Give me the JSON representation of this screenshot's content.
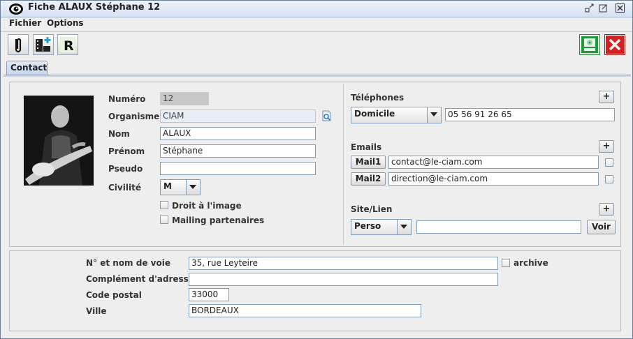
{
  "window": {
    "title": "Fiche ALAUX Stéphane 12"
  },
  "menu": {
    "items": [
      "Fichier",
      "Options"
    ]
  },
  "tabs": [
    "Contact"
  ],
  "identity": {
    "numero_label": "Numéro",
    "numero_value": "12",
    "organisme_label": "Organisme",
    "organisme_value": "CIAM",
    "nom_label": "Nom",
    "nom_value": "ALAUX",
    "prenom_label": "Prénom",
    "prenom_value": "Stéphane",
    "pseudo_label": "Pseudo",
    "pseudo_value": "",
    "civilite_label": "Civilité",
    "civilite_value": "M",
    "droit_image_label": "Droit à l'image",
    "mailing_label": "Mailing partenaires"
  },
  "telephones": {
    "heading": "Téléphones",
    "add": "+",
    "type": "Domicile",
    "number": "05 56 91 26 65"
  },
  "emails": {
    "heading": "Emails",
    "add": "+",
    "rows": [
      {
        "button": "Mail1",
        "value": "contact@le-ciam.com"
      },
      {
        "button": "Mail2",
        "value": "direction@le-ciam.com"
      }
    ]
  },
  "site": {
    "heading": "Site/Lien",
    "add": "+",
    "type": "Perso",
    "value": "",
    "voir_button": "Voir"
  },
  "address": {
    "voie_label": "N° et nom de voie",
    "voie_value": "35, rue Leyteire",
    "archive_label": "archive",
    "complement_label": "Complément d'adresse",
    "complement_value": "",
    "cp_label": "Code postal",
    "cp_value": "33000",
    "ville_label": "Ville",
    "ville_value": "BORDEAUX"
  }
}
